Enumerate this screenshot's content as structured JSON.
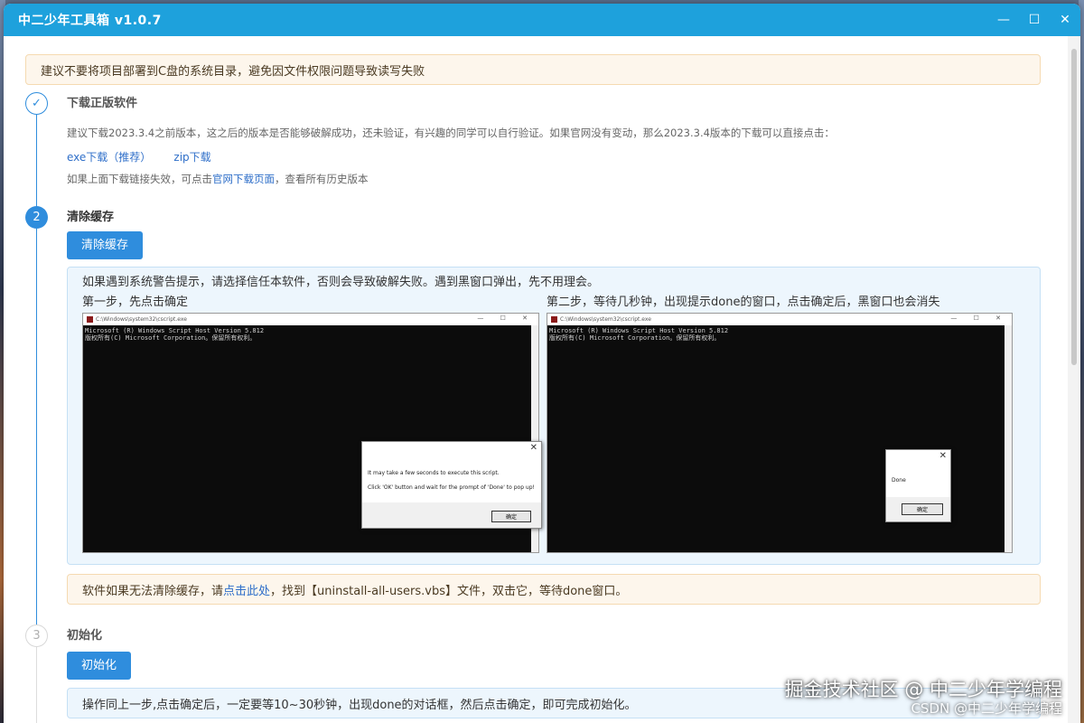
{
  "window": {
    "title": "中二少年工具箱 v1.0.7",
    "controls": {
      "minimize": "—",
      "maximize": "☐",
      "close": "✕"
    }
  },
  "warning": "建议不要将项目部署到C盘的系统目录，避免因文件权限问题导致读写失败",
  "step1": {
    "icon": "✓",
    "title": "下载正版软件",
    "desc": "建议下载2023.3.4之前版本，这之后的版本是否能够破解成功，还未验证，有兴趣的同学可以自行验证。如果官网没有变动，那么2023.3.4版本的下载可以直接点击：",
    "link_exe": "exe下载（推荐）",
    "link_zip": "zip下载",
    "fallback_before": "如果上面下载链接失效，可点击",
    "fallback_link": "官网下载页面",
    "fallback_after": "，查看所有历史版本"
  },
  "step2": {
    "number": "2",
    "title": "清除缓存",
    "button": "清除缓存",
    "info": "如果遇到系统警告提示，请选择信任本软件，否则会导致破解失败。遇到黑窗口弹出，先不用理会。",
    "caption_left": "第一步，先点击确定",
    "caption_right": "第二步，等待几秒钟，出现提示done的窗口，点击确定后，黑窗口也会消失",
    "console_left": {
      "path": "C:\\Windows\\system32\\cscript.exe",
      "line1": "Microsoft (R) Windows Script Host Version 5.812",
      "line2": "版权所有(C) Microsoft Corporation。保留所有权利。",
      "dialog_line1": "It may take a few seconds to execute this script.",
      "dialog_line2": "Click 'OK' button and wait for the prompt of 'Done' to pop up!",
      "ok": "确定",
      "close": "✕"
    },
    "console_right": {
      "path": "C:\\Windows\\system32\\cscript.exe",
      "line1": "Microsoft (R) Windows Script Host Version 5.812",
      "line2": "版权所有(C) Microsoft Corporation。保留所有权利。",
      "dialog_line1": "Done",
      "ok": "确定",
      "close": "✕"
    },
    "tip_before": "软件如果无法清除缓存，请",
    "tip_link": "点击此处",
    "tip_after": "，找到【uninstall-all-users.vbs】文件，双击它，等待done窗口。"
  },
  "step3": {
    "number": "3",
    "title": "初始化",
    "button": "初始化",
    "info": "操作同上一步,点击确定后，一定要等10~30秒钟，出现done的对话框，然后点击确定，即可完成初始化。"
  },
  "watermark": {
    "line1": "掘金技术社区 @ 中二少年学编程",
    "line2": "CSDN @中二少年学编程"
  }
}
